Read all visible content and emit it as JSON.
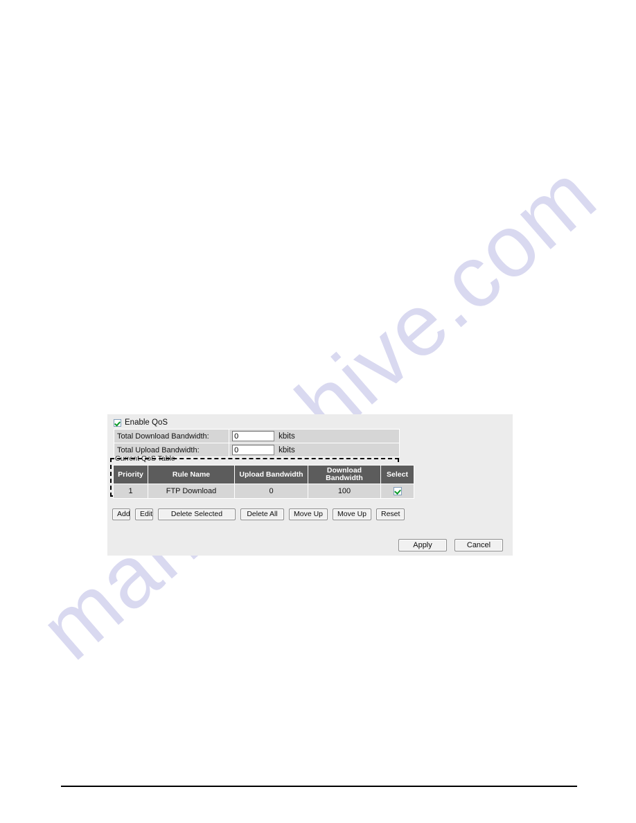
{
  "page": {
    "background_color": "#ffffff",
    "watermark_text": "manualshive.com",
    "watermark_color": "#d9d9f0"
  },
  "panel": {
    "background_color": "#ececec",
    "enable_qos": {
      "label": "Enable QoS",
      "checked": true,
      "check_color": "#0a9a28"
    },
    "bandwidth_rows": [
      {
        "label": "Total Download Bandwidth:",
        "value": "0",
        "placeholder": "0",
        "unit": "kbits"
      },
      {
        "label": "Total Upload Bandwidth:",
        "value": "0",
        "placeholder": "0",
        "unit": "kbits"
      }
    ],
    "qos_table": {
      "legend": "Current QoS Table",
      "header_bg": "#5c5c5c",
      "row_bg": "#d6d6d6",
      "columns": [
        "Priority",
        "Rule Name",
        "Upload Bandwidth",
        "Download Bandwidth",
        "Select"
      ],
      "rows": [
        {
          "priority": "1",
          "rule_name": "FTP Download",
          "upload_bandwidth": "0",
          "download_bandwidth": "100",
          "selected": true
        }
      ]
    },
    "action_buttons": [
      {
        "label": "Add"
      },
      {
        "label": "Edit"
      },
      {
        "label": "Delete Selected"
      },
      {
        "label": "Delete All"
      },
      {
        "label": "Move Up"
      },
      {
        "label": "Move Up"
      },
      {
        "label": "Reset"
      }
    ],
    "form_buttons": [
      {
        "label": "Apply"
      },
      {
        "label": "Cancel"
      }
    ]
  }
}
